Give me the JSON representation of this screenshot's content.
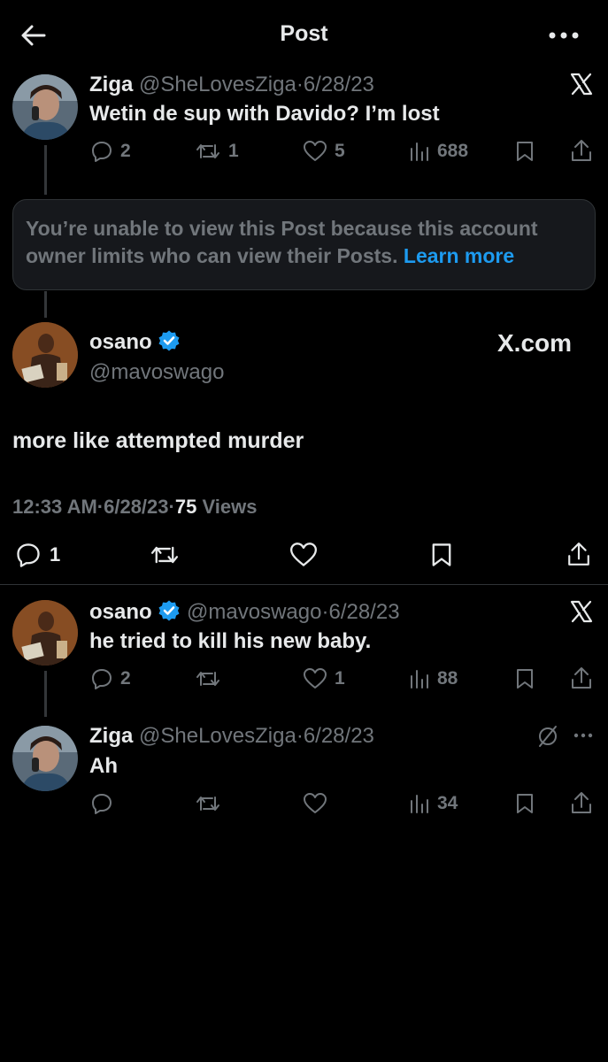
{
  "header": {
    "title": "Post"
  },
  "reply1": {
    "name": "Ziga",
    "handle": "@SheLovesZiga",
    "dot": "·",
    "date": "6/28/23",
    "text": "Wetin de sup with Davido? I’m lost",
    "replies": "2",
    "reposts": "1",
    "likes": "5",
    "views": "688"
  },
  "notice": {
    "text": "You’re unable to view this Post because this account owner limits who can view their Posts.",
    "link": "Learn more"
  },
  "main": {
    "name": "osano",
    "handle": "@mavoswago",
    "xcom": "X.com",
    "text": "more like attempted murder",
    "time": "12:33 AM",
    "date": "6/28/23",
    "dot": "·",
    "views_count": "75",
    "views_label": "Views",
    "replies": "1"
  },
  "reply2": {
    "name": "osano",
    "handle": "@mavoswago",
    "dot": "·",
    "date": "6/28/23",
    "text": "he tried to kill his new baby.",
    "replies": "2",
    "likes": "1",
    "views": "88"
  },
  "reply3": {
    "name": "Ziga",
    "handle": "@SheLovesZiga",
    "dot": "·",
    "date": "6/28/23",
    "text": "Ah",
    "views": "34"
  },
  "colors": {
    "background": "#000000",
    "text": "#e7e9ea",
    "muted": "#71767b",
    "link": "#1d9bf0",
    "verified": "#1d9bf0"
  }
}
